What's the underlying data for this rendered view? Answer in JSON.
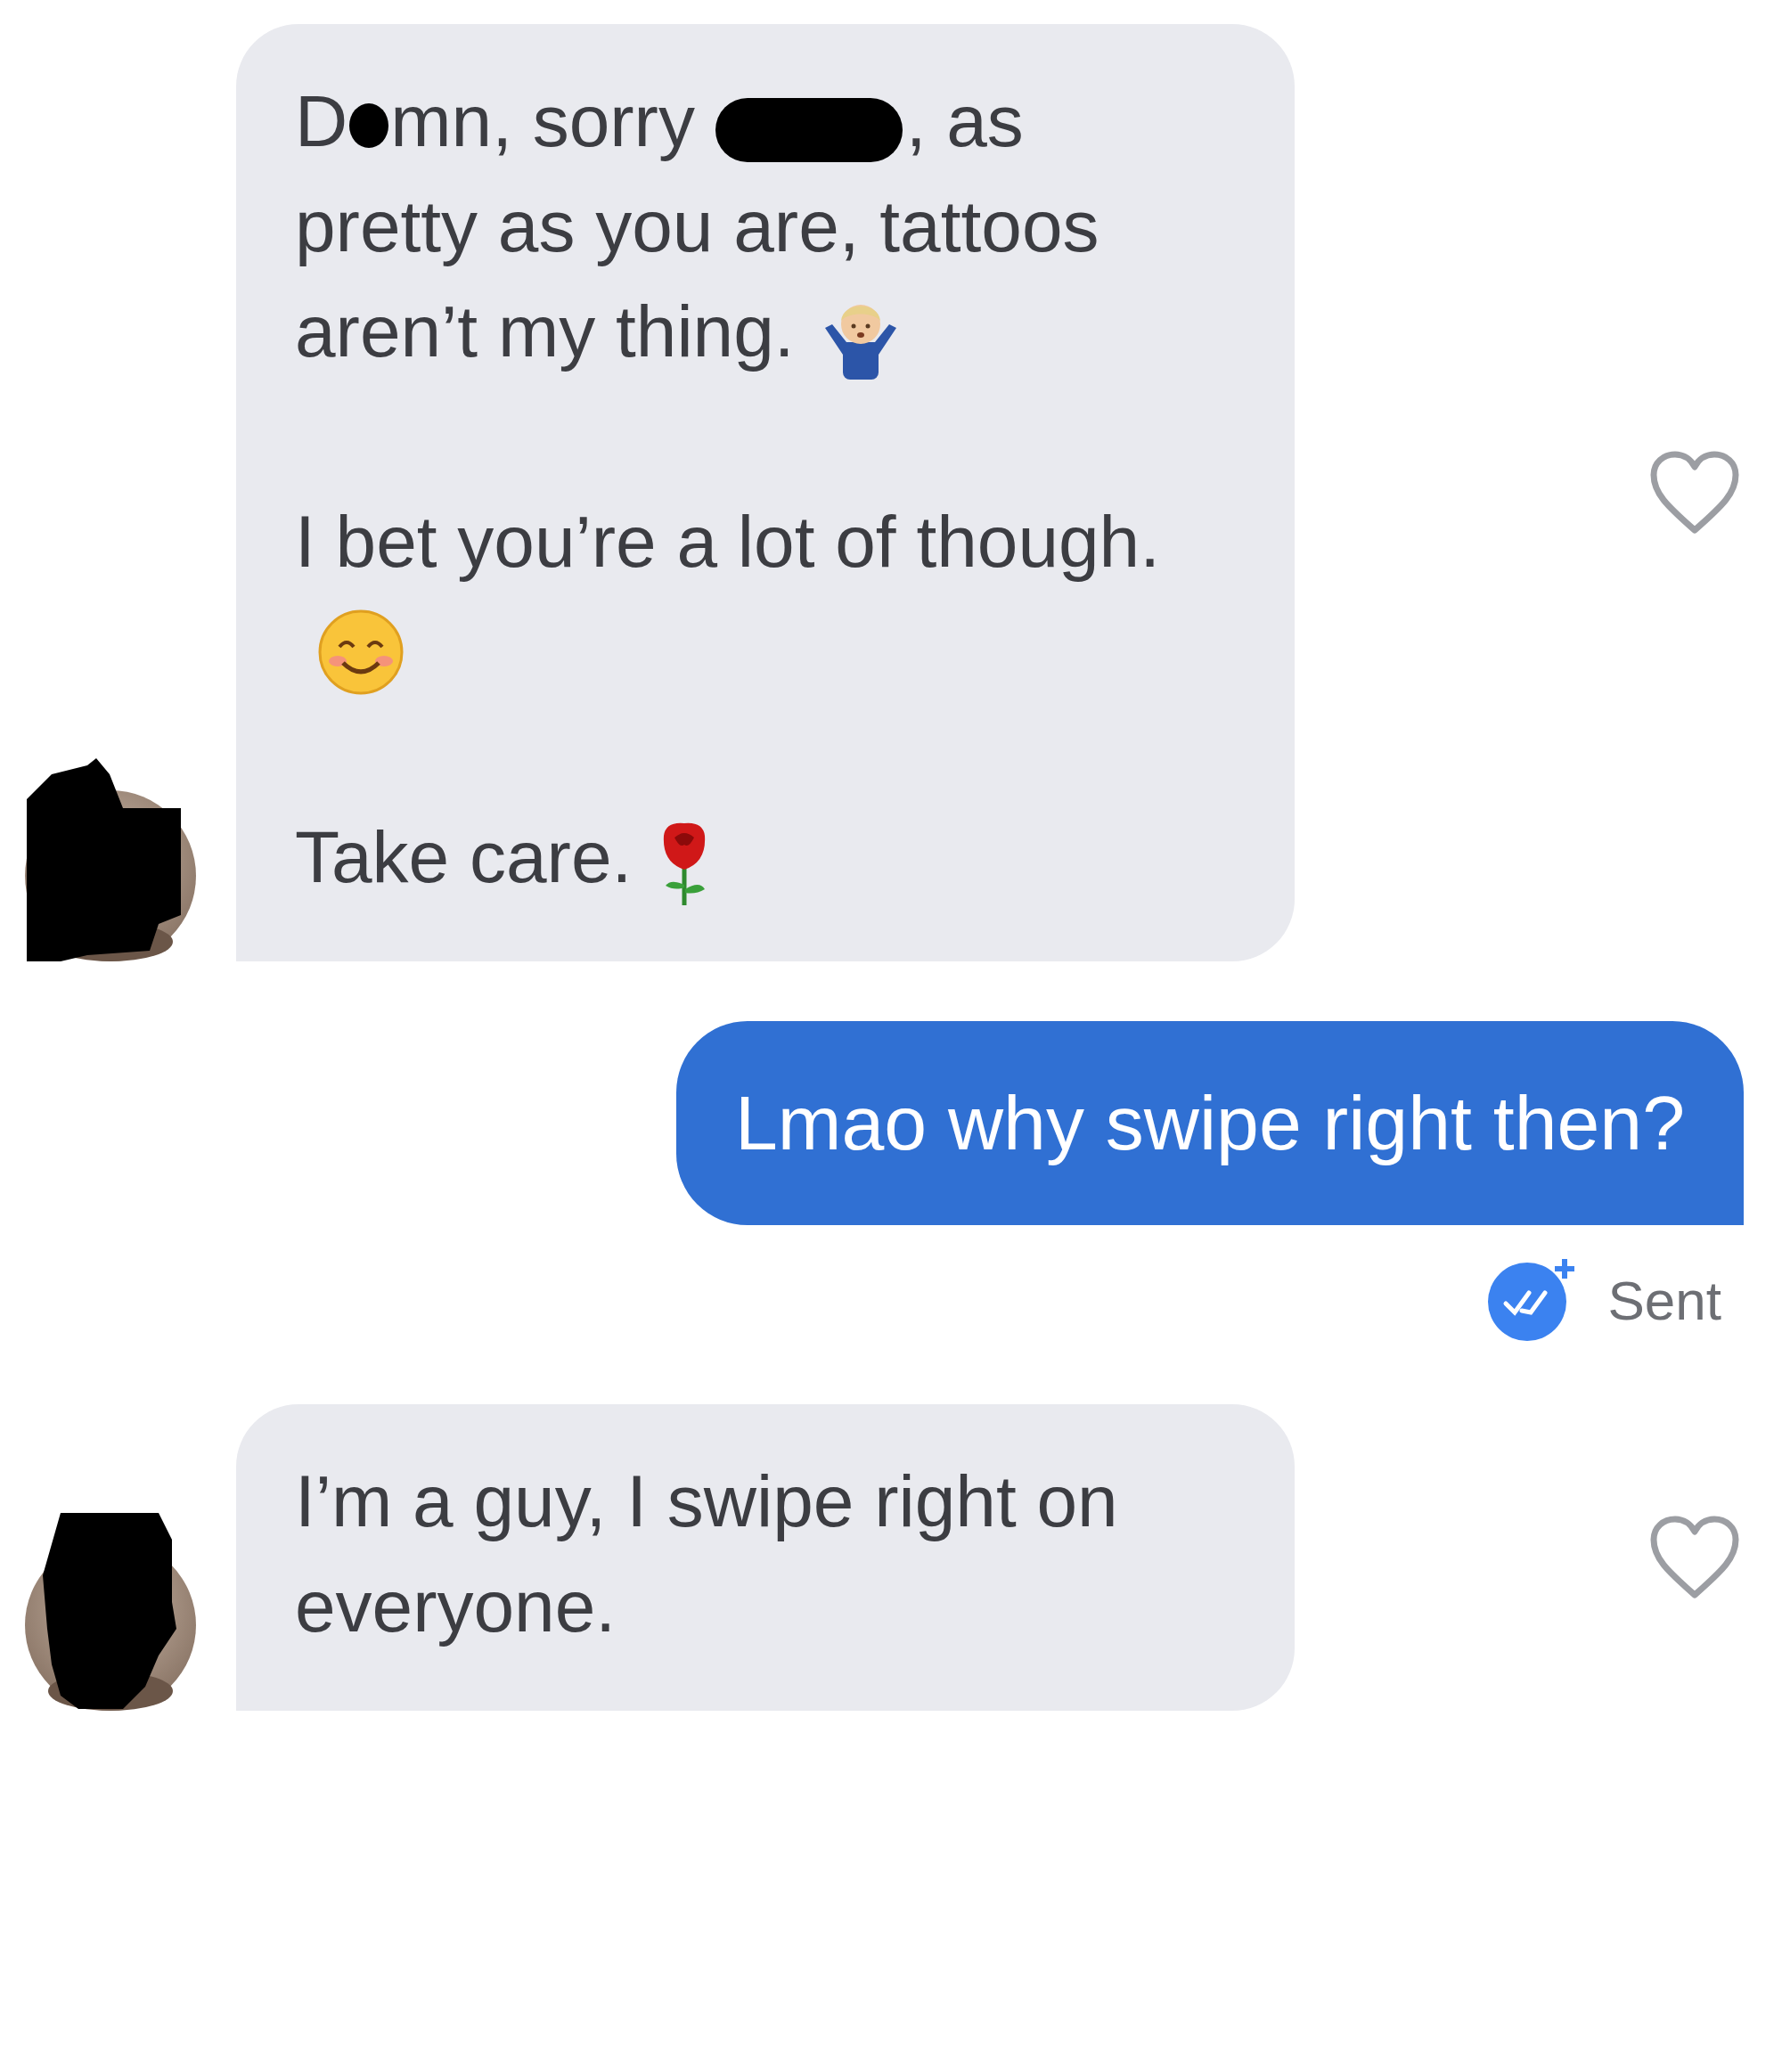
{
  "messages": [
    {
      "kind": "received",
      "liked": false,
      "paragraphs": [
        [
          {
            "kind": "text",
            "text": "D"
          },
          {
            "kind": "dot-redaction"
          },
          {
            "kind": "text",
            "text": "mn, sorry "
          },
          {
            "kind": "bar-redaction"
          },
          {
            "kind": "text",
            "text": ", as"
          },
          {
            "kind": "break"
          },
          {
            "kind": "text",
            "text": "pretty as you are, tattoos"
          },
          {
            "kind": "break"
          },
          {
            "kind": "text",
            "text": "aren’t my thing."
          },
          {
            "kind": "shrug"
          }
        ],
        [
          {
            "kind": "text",
            "text": "I bet you’re a lot of though."
          },
          {
            "kind": "break"
          },
          {
            "kind": "smile"
          }
        ],
        [
          {
            "kind": "text",
            "text": "Take care."
          },
          {
            "kind": "rose"
          }
        ]
      ]
    },
    {
      "kind": "sent",
      "text": "Lmao why swipe right then?",
      "read": true,
      "status": "Sent"
    },
    {
      "kind": "received",
      "liked": false,
      "paragraphs": [
        [
          {
            "kind": "text",
            "text": "I’m a guy, I swipe right on"
          },
          {
            "kind": "break"
          },
          {
            "kind": "text",
            "text": "everyone."
          }
        ]
      ]
    }
  ]
}
